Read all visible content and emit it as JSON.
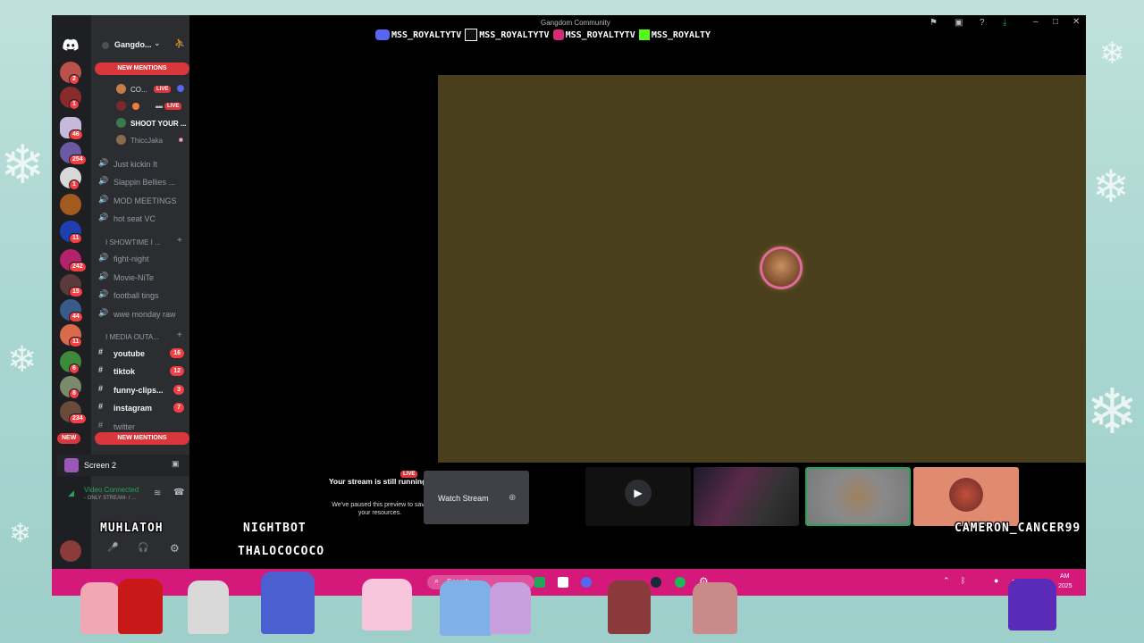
{
  "window": {
    "title": "Gangdom Community"
  },
  "socials": [
    {
      "icon": "discord-icon",
      "label": "MSS_ROYALTYTV"
    },
    {
      "icon": "tiktok-icon",
      "label": "MSS_ROYALTYTV"
    },
    {
      "icon": "instagram-icon",
      "label": "MSS_ROYALTYTV"
    },
    {
      "icon": "kick-icon",
      "label": "MSS_ROYALTY"
    }
  ],
  "server": {
    "name": "Gangdo...",
    "new_mentions_top": "NEW MENTIONS",
    "new_mentions_bottom": "NEW MENTIONS",
    "new_badge": "NEW"
  },
  "rail_badges": [
    "2",
    "1",
    "46",
    "254",
    "1",
    "11",
    "242",
    "15",
    "44",
    "11",
    "6",
    "8",
    "234"
  ],
  "voice_users": [
    {
      "name": "CO...",
      "live": "LIVE"
    },
    {
      "name": "",
      "live": "LIVE"
    },
    {
      "name": "SHOOT YOUR ..."
    },
    {
      "name": "ThiccJaka"
    }
  ],
  "voice_channels": [
    {
      "label": "Just kickin It"
    },
    {
      "label": "Slappin Bellies ..."
    },
    {
      "label": "MOD MEETINGS"
    },
    {
      "label": "hot seat VC"
    }
  ],
  "category_showtime": "I SHOWTIME I ...",
  "showtime_channels": [
    {
      "label": "fight-night"
    },
    {
      "label": "Movie-NiTe"
    },
    {
      "label": "football tings"
    },
    {
      "label": "wwe monday raw"
    }
  ],
  "category_media": "I MEDIA OUTA...",
  "text_channels": [
    {
      "label": "youtube",
      "count": "16"
    },
    {
      "label": "tiktok",
      "count": "12"
    },
    {
      "label": "funny-clips...",
      "count": "3"
    },
    {
      "label": "instagram",
      "count": "7"
    },
    {
      "label": "twitter",
      "count": ""
    }
  ],
  "screen_share": {
    "label": "Screen 2"
  },
  "voice_status": {
    "title": "Video Connected",
    "sub": "- ONLY STREAM- / ..."
  },
  "stream_preview": {
    "title": "Your stream is still running!",
    "body": "We've paused this preview to save your resources.",
    "live": "LIVE",
    "watch_label": "Watch Stream"
  },
  "overlay_names": [
    "NIGHTBOT",
    "MUHLATOH",
    "THALOCOCOCO",
    "CAMERON_CANCER99"
  ],
  "taskbar": {
    "search": "Search",
    "time": "AM",
    "year": "2025"
  },
  "colors": {
    "accent_red": "#da373c",
    "discord_bg": "#2b2d31",
    "rail_bg": "#1e1f22",
    "stage": "#4a3f1d",
    "taskbar": "#d5197a"
  }
}
